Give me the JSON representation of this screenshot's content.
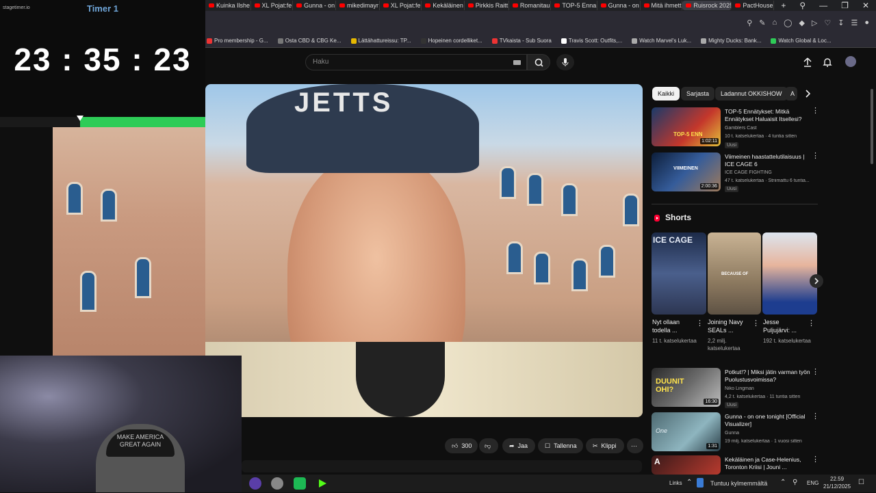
{
  "timer": {
    "brand": "stagetimer.io",
    "title": "Timer 1",
    "value": "23 : 35 : 23",
    "remaining_fraction": 0.61
  },
  "browser": {
    "tabs": [
      "Kuinka Ilshe",
      "XL Pojat:fe",
      "Gunna - on",
      "mikedimayr",
      "XL Pojat:fe",
      "Kekäläinen",
      "Pirkkis Raitt",
      "Romanitau",
      "TOP-5 Enna",
      "Gunna - on",
      "Mitä ihmett",
      "Ruisrock 2025",
      "PactHouse"
    ],
    "active_tab_index": 11,
    "new_tab_label": "+",
    "bookmarks": [
      "Pro membership - G...",
      "Osta CBD & CBG Ke...",
      "Lättähattureissu: TP...",
      "Hopeinen cordelliket...",
      "TVkaista - Sub Suora",
      "Travis Scott: Outfits,...",
      "Watch Marvel's Luk...",
      "Mighty Ducks: Bank...",
      "Watch Global & Loc..."
    ]
  },
  "youtube": {
    "search_placeholder": "Haku",
    "cap_text": "JETTS",
    "webcam_cap_text": "MAKE AMERICA GREAT AGAIN",
    "actions": {
      "like_count": "300",
      "share": "Jaa",
      "save": "Tallenna",
      "clip": "Klippi"
    },
    "chips": [
      "Kaikki",
      "Sarjasta",
      "Ladannut OKKISHOW",
      "A"
    ],
    "videos_top": [
      {
        "title": "TOP-5 Ennätykset: Mitkä Ennätykset Haluaisit Itsellesi?",
        "channel": "Gamblers Cast",
        "meta": "10 t. katselukertaa · 4 tuntia sitten",
        "badge": "Uusi",
        "duration": "1:02:11",
        "thumb_text": "TOP-5 ENN"
      },
      {
        "title": "Viimeinen haastattelutilaisuus | ICE CAGE 6",
        "channel": "ICE CAGE FIGHTING",
        "meta": "47 t. katselukertaa · Striimattu 6 tuntia...",
        "badge": "Uusi",
        "duration": "2:00:36",
        "thumb_text": "VIIMEINEN"
      }
    ],
    "shorts_heading": "Shorts",
    "shorts": [
      {
        "title": "Nyt ollaan todella ...",
        "views": "11 t. katselukertaa",
        "thumb_text": "ICE CAGE"
      },
      {
        "title": "Joining Navy SEALs ...",
        "views": "2,2 milj. katselukertaa",
        "thumb_text": "BECAUSE OF"
      },
      {
        "title": "Jesse Puljujärvi: ...",
        "views": "192 t. katselukertaa",
        "thumb_text": ""
      }
    ],
    "videos_bottom": [
      {
        "title": "Potkut!? | Miksi jätin varman työn Puolustusvoimissa?",
        "channel": "Niko Lingman",
        "meta": "4,2 t. katselukertaa · 11 tuntia sitten",
        "badge": "Uusi",
        "duration": "16:30",
        "thumb_text": "DUUNIT OHI?"
      },
      {
        "title": "Gunna - on one tonight [Official Visualizer]",
        "channel": "Gunna",
        "meta": "19 milj. katselukertaa · 1 vuosi sitten",
        "badge": "",
        "duration": "1:31",
        "thumb_text": "One"
      },
      {
        "title": "Kekäläinen ja Case-Helenius, Toronton Kriisi | Jouni ...",
        "channel": "",
        "meta": "",
        "badge": "",
        "duration": "",
        "thumb_text": "A"
      }
    ]
  },
  "taskbar": {
    "links": "Links",
    "now_playing": "Tuntuu kylmemmältä",
    "lang": "ENG",
    "time": "22.59",
    "date": "21/12/2025"
  }
}
